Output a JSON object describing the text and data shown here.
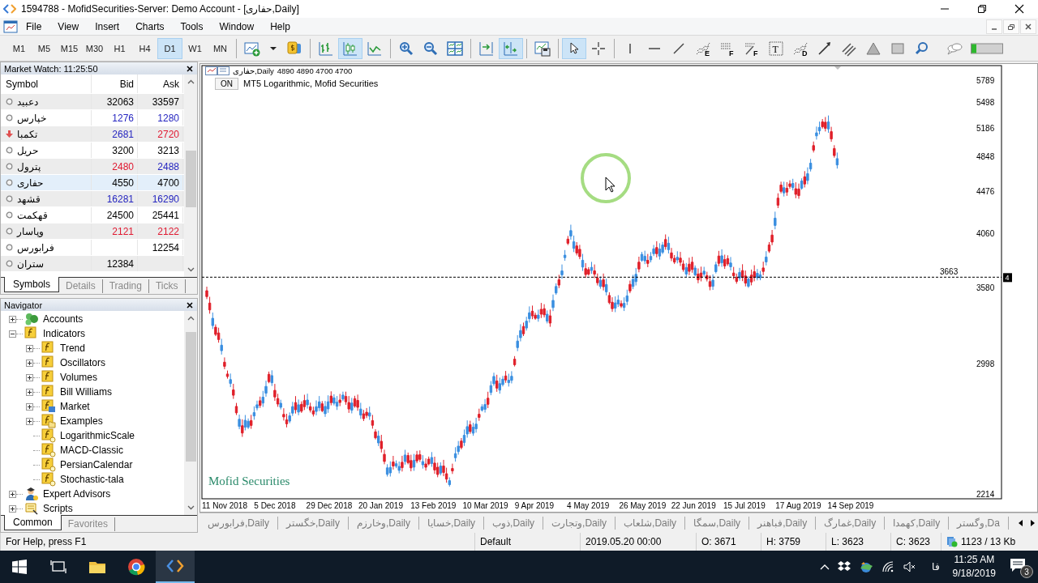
{
  "window": {
    "title": "1594788 - MofidSecurities-Server: Demo Account - [حفاری,Daily]"
  },
  "menu": [
    "File",
    "View",
    "Insert",
    "Charts",
    "Tools",
    "Window",
    "Help"
  ],
  "timeframes": [
    {
      "label": "M1",
      "selected": false
    },
    {
      "label": "M5",
      "selected": false
    },
    {
      "label": "M15",
      "selected": false
    },
    {
      "label": "M30",
      "selected": false
    },
    {
      "label": "H1",
      "selected": false
    },
    {
      "label": "H4",
      "selected": false
    },
    {
      "label": "D1",
      "selected": true
    },
    {
      "label": "W1",
      "selected": false
    },
    {
      "label": "MN",
      "selected": false
    }
  ],
  "toolbar": [
    {
      "kind": "new-chart",
      "selected": false
    },
    {
      "kind": "dropdown",
      "selected": false
    },
    {
      "kind": "market",
      "selected": false
    },
    {
      "kind": "separator"
    },
    {
      "kind": "bar-chart",
      "selected": false
    },
    {
      "kind": "candles",
      "selected": true
    },
    {
      "kind": "line-chart",
      "selected": false
    },
    {
      "kind": "separator"
    },
    {
      "kind": "zoom-in",
      "selected": false
    },
    {
      "kind": "zoom-out",
      "selected": false
    },
    {
      "kind": "tile",
      "selected": false
    },
    {
      "kind": "separator"
    },
    {
      "kind": "shift",
      "selected": false
    },
    {
      "kind": "autoscroll",
      "selected": true
    },
    {
      "kind": "separator"
    },
    {
      "kind": "template",
      "selected": false
    },
    {
      "kind": "separator"
    },
    {
      "kind": "cursor",
      "selected": true
    },
    {
      "kind": "crosshair",
      "selected": false
    },
    {
      "kind": "separator"
    },
    {
      "kind": "vline",
      "selected": false
    },
    {
      "kind": "hline",
      "selected": false
    },
    {
      "kind": "trendline",
      "selected": false
    },
    {
      "kind": "fib-expansion",
      "glyph": "E",
      "selected": false
    },
    {
      "kind": "fib-grid",
      "glyph": "F",
      "selected": false
    },
    {
      "kind": "fib-fan",
      "glyph": "F",
      "selected": false
    },
    {
      "kind": "text",
      "glyph": "T",
      "selected": false
    },
    {
      "kind": "fib-wave",
      "glyph": "D",
      "selected": false
    },
    {
      "kind": "arrow",
      "selected": false
    },
    {
      "kind": "channel",
      "selected": false
    },
    {
      "kind": "triangle",
      "selected": false
    },
    {
      "kind": "rectangle",
      "selected": false
    },
    {
      "kind": "search",
      "selected": false
    },
    {
      "kind": "chat",
      "selected": false
    },
    {
      "kind": "signal",
      "selected": false
    }
  ],
  "market_watch": {
    "title": "Market Watch: 11:25:50",
    "columns": [
      "Symbol",
      "Bid",
      "Ask"
    ],
    "rows": [
      {
        "symbol": "دعبید",
        "kind": "dot",
        "bid": {
          "text": "32063",
          "color": "#000000"
        },
        "ask": {
          "text": "33597",
          "color": "#000000"
        },
        "selected": false
      },
      {
        "symbol": "خپارس",
        "kind": "dot",
        "bid": {
          "text": "1276",
          "color": "#2525c0"
        },
        "ask": {
          "text": "1280",
          "color": "#2525c0"
        },
        "selected": false
      },
      {
        "symbol": "تکمبا",
        "kind": "alert",
        "bid": {
          "text": "2681",
          "color": "#2525c0"
        },
        "ask": {
          "text": "2720",
          "color": "#e01830"
        },
        "selected": false
      },
      {
        "symbol": "حریل",
        "kind": "dot",
        "bid": {
          "text": "3200",
          "color": "#000000"
        },
        "ask": {
          "text": "3213",
          "color": "#000000"
        },
        "selected": false
      },
      {
        "symbol": "پترول",
        "kind": "dot",
        "bid": {
          "text": "2480",
          "color": "#e01830"
        },
        "ask": {
          "text": "2488",
          "color": "#2525c0"
        },
        "selected": false
      },
      {
        "symbol": "حفاری",
        "kind": "dot",
        "bid": {
          "text": "4550",
          "color": "#000000"
        },
        "ask": {
          "text": "4700",
          "color": "#000000"
        },
        "selected": true
      },
      {
        "symbol": "قشهد",
        "kind": "dot",
        "bid": {
          "text": "16281",
          "color": "#2525c0"
        },
        "ask": {
          "text": "16290",
          "color": "#2525c0"
        },
        "selected": false
      },
      {
        "symbol": "قهکمت",
        "kind": "dot",
        "bid": {
          "text": "24500",
          "color": "#000000"
        },
        "ask": {
          "text": "25441",
          "color": "#000000"
        },
        "selected": false
      },
      {
        "symbol": "وپاسار",
        "kind": "dot",
        "bid": {
          "text": "2121",
          "color": "#e01830"
        },
        "ask": {
          "text": "2122",
          "color": "#e01830"
        },
        "selected": false
      },
      {
        "symbol": "فرابورس",
        "kind": "dot",
        "ask": {
          "text": "12254",
          "color": "#000000"
        },
        "selected": false
      },
      {
        "symbol": "ستران",
        "kind": "dot",
        "bid": {
          "text": "12384",
          "color": "#000000"
        },
        "selected": false
      }
    ],
    "tabs": [
      {
        "label": "Symbols",
        "selected": true
      },
      {
        "label": "Details",
        "selected": false
      },
      {
        "label": "Trading",
        "selected": false
      },
      {
        "label": "Ticks",
        "selected": false
      }
    ]
  },
  "navigator": {
    "title": "Navigator",
    "tree": [
      {
        "label": "Accounts",
        "kind": "accounts",
        "expanded": false
      },
      {
        "label": "Indicators",
        "kind": "folder",
        "expanded": true,
        "children": [
          {
            "label": "Trend",
            "kind": "folder",
            "expanded": false
          },
          {
            "label": "Oscillators",
            "kind": "folder",
            "expanded": false
          },
          {
            "label": "Volumes",
            "kind": "folder",
            "expanded": false
          },
          {
            "label": "Bill Williams",
            "kind": "folder",
            "expanded": false
          },
          {
            "label": "Market",
            "kind": "market",
            "expanded": false
          },
          {
            "label": "Examples",
            "kind": "examples",
            "expanded": false
          },
          {
            "label": "LogarithmicScale",
            "kind": "indicator"
          },
          {
            "label": "MACD-Classic",
            "kind": "indicator"
          },
          {
            "label": "PersianCalendar",
            "kind": "indicator"
          },
          {
            "label": "Stochastic-tala",
            "kind": "indicator"
          }
        ]
      },
      {
        "label": "Expert Advisors",
        "kind": "experts",
        "expanded": false
      },
      {
        "label": "Scripts",
        "kind": "scripts",
        "expanded": false
      }
    ],
    "tabs": [
      {
        "label": "Common",
        "selected": true
      },
      {
        "label": "Favorites",
        "selected": false
      }
    ]
  },
  "chart": {
    "symbol_line": "حفاری,Daily",
    "ohlc": "4890 4890 4700 4700",
    "indicator_toggle": {
      "label": "ON",
      "on": true
    },
    "indicator_label": "MT5 Logarithmic, Mofid Securities",
    "broker_label": "Mofid Securities",
    "price_ticks": [
      "5789",
      "5498",
      "5186",
      "4848",
      "4476",
      "4060",
      "3580",
      "2998",
      "2214"
    ],
    "price_line": {
      "label": "3663"
    },
    "price_marker": "4",
    "date_ticks": [
      "11 Nov 2018",
      "5 Dec 2018",
      "29 Dec 2018",
      "20 Jan 2019",
      "13 Feb 2019",
      "10 Mar 2019",
      "9 Apr 2019",
      "4 May 2019",
      "26 May 2019",
      "22 Jun 2019",
      "15 Jul 2019",
      "17 Aug 2019",
      "14 Sep 2019"
    ]
  },
  "chart_tabs": [
    {
      "label": "فرابورس,Daily",
      "selected": false
    },
    {
      "label": "خگستر,Daily",
      "selected": false
    },
    {
      "label": "وخارزم,Daily",
      "selected": false
    },
    {
      "label": "خسایا,Daily",
      "selected": false
    },
    {
      "label": "ذوب,Daily",
      "selected": false
    },
    {
      "label": "وتجارت,Daily",
      "selected": false
    },
    {
      "label": "شلعاب,Daily",
      "selected": false
    },
    {
      "label": "سمگا,Daily",
      "selected": false
    },
    {
      "label": "فباهنر,Daily",
      "selected": false
    },
    {
      "label": "غمارگ,Daily",
      "selected": false
    },
    {
      "label": "کهمدا,Daily",
      "selected": false
    },
    {
      "label": "وگستر,Da",
      "selected": false
    }
  ],
  "status_bar": {
    "help": "For Help, press F1",
    "profile": "Default",
    "time": "2019.05.20 00:00",
    "open": "O: 3671",
    "high": "H: 3759",
    "low": "L: 3623",
    "close": "C: 3623",
    "traffic": "1123 / 13 Kb"
  },
  "taskbar": {
    "apps": [
      {
        "kind": "explorer",
        "active": false
      },
      {
        "kind": "browser",
        "active": false
      },
      {
        "kind": "terminal",
        "active": true
      }
    ],
    "language": "فا",
    "time": "11:25 AM",
    "date": "9/18/2019",
    "notifications": "3"
  }
}
